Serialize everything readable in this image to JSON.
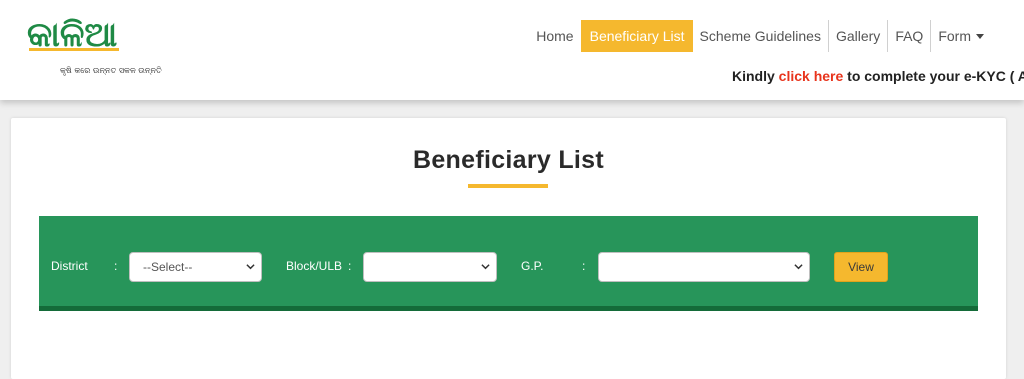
{
  "header": {
    "logo_text": "କାଳିଆ",
    "logo_tagline": "କୃଷି କରେ ଉନ୍ନତ ସକଳ ଉନ୍ନତି"
  },
  "nav": {
    "items": [
      {
        "label": "Home",
        "active": false
      },
      {
        "label": "Beneficiary List",
        "active": true
      },
      {
        "label": "Scheme Guidelines",
        "active": false
      },
      {
        "label": "Gallery",
        "active": false
      },
      {
        "label": "FAQ",
        "active": false
      },
      {
        "label": "Form",
        "active": false,
        "has_dropdown": true
      }
    ]
  },
  "notice": {
    "prefix": "Kindly ",
    "link_text": "click here",
    "suffix": " to complete your e-KYC ( A"
  },
  "page": {
    "title": "Beneficiary List"
  },
  "filters": {
    "district_label": "District",
    "district_value": "--Select--",
    "block_label": "Block/ULB",
    "block_value": "",
    "gp_label": "G.P.",
    "gp_value": "",
    "colon": ":",
    "view_label": "View"
  },
  "colors": {
    "accent": "#f5b82e",
    "filter_bar": "#27955a",
    "filter_bar_border": "#146b39",
    "link_red": "#e8341c",
    "logo_green": "#1f8a45"
  }
}
